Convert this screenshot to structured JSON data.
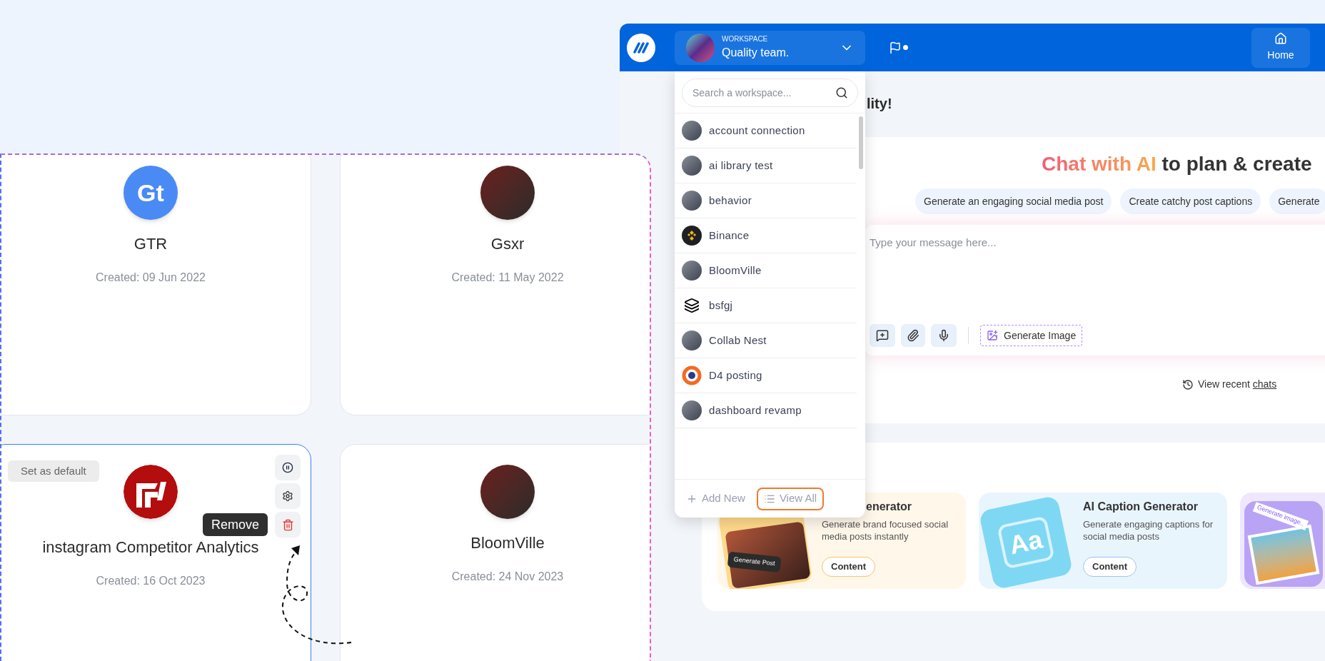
{
  "workspace_grid": {
    "cards": [
      {
        "name": "GTR",
        "created": "Created: 09 Jun 2022",
        "selected": false,
        "avatar": {
          "kind": "monogram",
          "text": "Gt"
        }
      },
      {
        "name": "Gsxr",
        "created": "Created: 11 May 2022",
        "selected": false,
        "avatar": {
          "kind": "photo"
        }
      },
      {
        "name": "instagram Competitor Analytics",
        "created": "Created: 16 Oct 2023",
        "selected": true,
        "avatar": {
          "kind": "brand"
        },
        "default_label": "Set as default",
        "actions": [
          {
            "kind": "pause"
          },
          {
            "kind": "settings"
          },
          {
            "kind": "remove",
            "tooltip": "Remove"
          }
        ]
      },
      {
        "name": "BloomVille",
        "created": "Created: 24 Nov 2023",
        "selected": false,
        "avatar": {
          "kind": "photo"
        }
      }
    ]
  },
  "app": {
    "header": {
      "workspace_label": "WORKSPACE",
      "workspace_name": "Quality team.",
      "nav": [
        {
          "label": "Home",
          "selected": true
        }
      ]
    },
    "dropdown": {
      "placeholder": "Search a workspace...",
      "items": [
        {
          "name": "account connection",
          "kind": "photo"
        },
        {
          "name": "ai library test",
          "kind": "photo"
        },
        {
          "name": "behavior",
          "kind": "photo"
        },
        {
          "name": "Binance",
          "kind": "binance"
        },
        {
          "name": "BloomVille",
          "kind": "photo"
        },
        {
          "name": "bsfgj",
          "kind": "layers"
        },
        {
          "name": "Collab Nest",
          "kind": "photo"
        },
        {
          "name": "D4 posting",
          "kind": "ring"
        },
        {
          "name": "dashboard revamp",
          "kind": "photo"
        }
      ],
      "add_label": "Add New",
      "view_all": {
        "label": "View All",
        "highlighted": true
      }
    },
    "greeting": "lity!",
    "chat": {
      "heading_highlight": "Chat with AI",
      "heading_rest": "to plan & create",
      "chips": [
        "Generate an engaging social media post",
        "Create catchy post captions",
        "Generate"
      ],
      "placeholder": "Type your message here...",
      "generate_image": "Generate Image",
      "recent_prefix": "View recent ",
      "recent_link": "chats"
    },
    "tools": [
      {
        "kind": "post",
        "title": "enerator",
        "description": "Generate brand focused social media posts instantly",
        "tag": "Content",
        "art_label": "Generate Post"
      },
      {
        "kind": "caption",
        "title": "AI Caption Generator",
        "description": "Generate engaging captions for social media posts",
        "tag": "Content",
        "art_label": "Aa"
      },
      {
        "kind": "image",
        "art_label": "Generate image.."
      }
    ]
  }
}
